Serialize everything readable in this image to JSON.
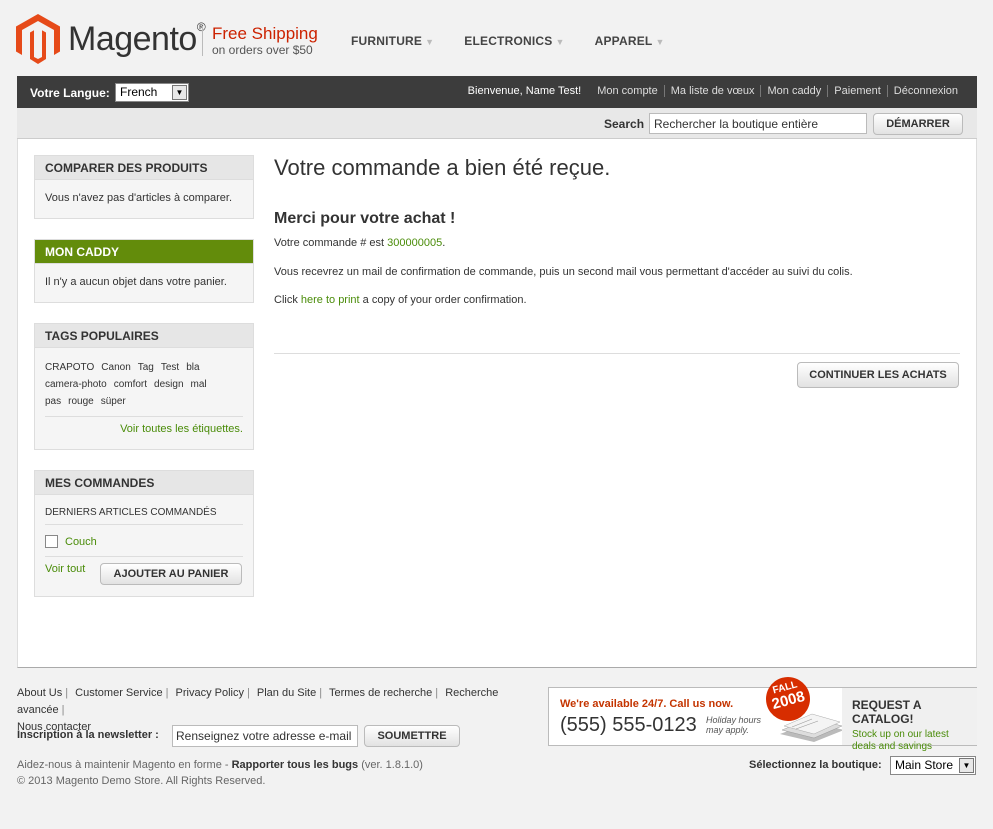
{
  "header": {
    "logo_text": "Magento",
    "logo_reg": "®",
    "shipping_main": "Free Shipping",
    "shipping_sub": "on orders over $50",
    "nav": [
      "FURNITURE",
      "ELECTRONICS",
      "APPAREL"
    ]
  },
  "topbar": {
    "language_label": "Votre Langue:",
    "language_value": "French",
    "welcome": "Bienvenue, Name Test!",
    "links": [
      "Mon compte",
      "Ma liste de vœux",
      "Mon caddy",
      "Paiement",
      "Déconnexion"
    ]
  },
  "search": {
    "label": "Search",
    "value": "Rechercher la boutique entière",
    "button": "DÉMARRER"
  },
  "sidebar": {
    "compare": {
      "title": "COMPARER DES PRODUITS",
      "text": "Vous n'avez pas d'articles à comparer."
    },
    "cart": {
      "title": "MON CADDY",
      "text": "Il n'y a aucun objet dans votre panier."
    },
    "tags": {
      "title": "TAGS POPULAIRES",
      "items": [
        "CRAPOTO",
        "Canon",
        "Tag",
        "Test",
        "bla",
        "camera-photo",
        "comfort",
        "design",
        "mal",
        "pas",
        "rouge",
        "süper"
      ],
      "view_all": "Voir toutes les étiquettes."
    },
    "orders": {
      "title": "MES COMMANDES",
      "subtitle": "DERNIERS ARTICLES COMMANDÉS",
      "item": "Couch",
      "view_all": "Voir tout",
      "add_button": "AJOUTER AU PANIER"
    }
  },
  "content": {
    "title": "Votre commande a bien été reçue.",
    "subtitle": "Merci pour votre achat !",
    "order_prefix": "Votre commande # est ",
    "order_number": "300000005",
    "order_suffix": ".",
    "confirmation": "Vous recevrez un mail de confirmation de commande, puis un second mail vous permettant d'accéder au suivi du colis.",
    "print_prefix": "Click ",
    "print_link": "here to print",
    "print_suffix": " a copy of your order confirmation.",
    "continue_button": "CONTINUER LES ACHATS"
  },
  "footer": {
    "links": [
      "About Us",
      "Customer Service",
      "Privacy Policy",
      "Plan du Site",
      "Termes de recherche",
      "Recherche avancée",
      "Nous contacter"
    ],
    "newsletter_label": "Inscription à la newsletter :",
    "newsletter_value": "Renseignez votre adresse e-mail",
    "newsletter_button": "SOUMETTRE",
    "help_prefix": "Aidez-nous à maintenir Magento en forme - ",
    "help_link": "Rapporter tous les bugs",
    "help_version": " (ver. 1.8.1.0)",
    "copyright": "© 2013 Magento Demo Store. All Rights Reserved.",
    "store_label": "Sélectionnez la boutique:",
    "store_value": "Main Store"
  },
  "banner": {
    "available": "We're available 24/7. Call us now.",
    "phone": "(555) 555-0123",
    "hours_line1": "Holiday hours",
    "hours_line2": "may apply.",
    "badge_top": "FALL",
    "badge_year": "2008",
    "request": "REQUEST A CATALOG!",
    "stock_line1": "Stock up on our latest",
    "stock_line2": "deals and savings"
  },
  "colors": {
    "accent_green": "#638c0b",
    "link_green": "#4a8c09",
    "brand_orange": "#d72d00"
  }
}
